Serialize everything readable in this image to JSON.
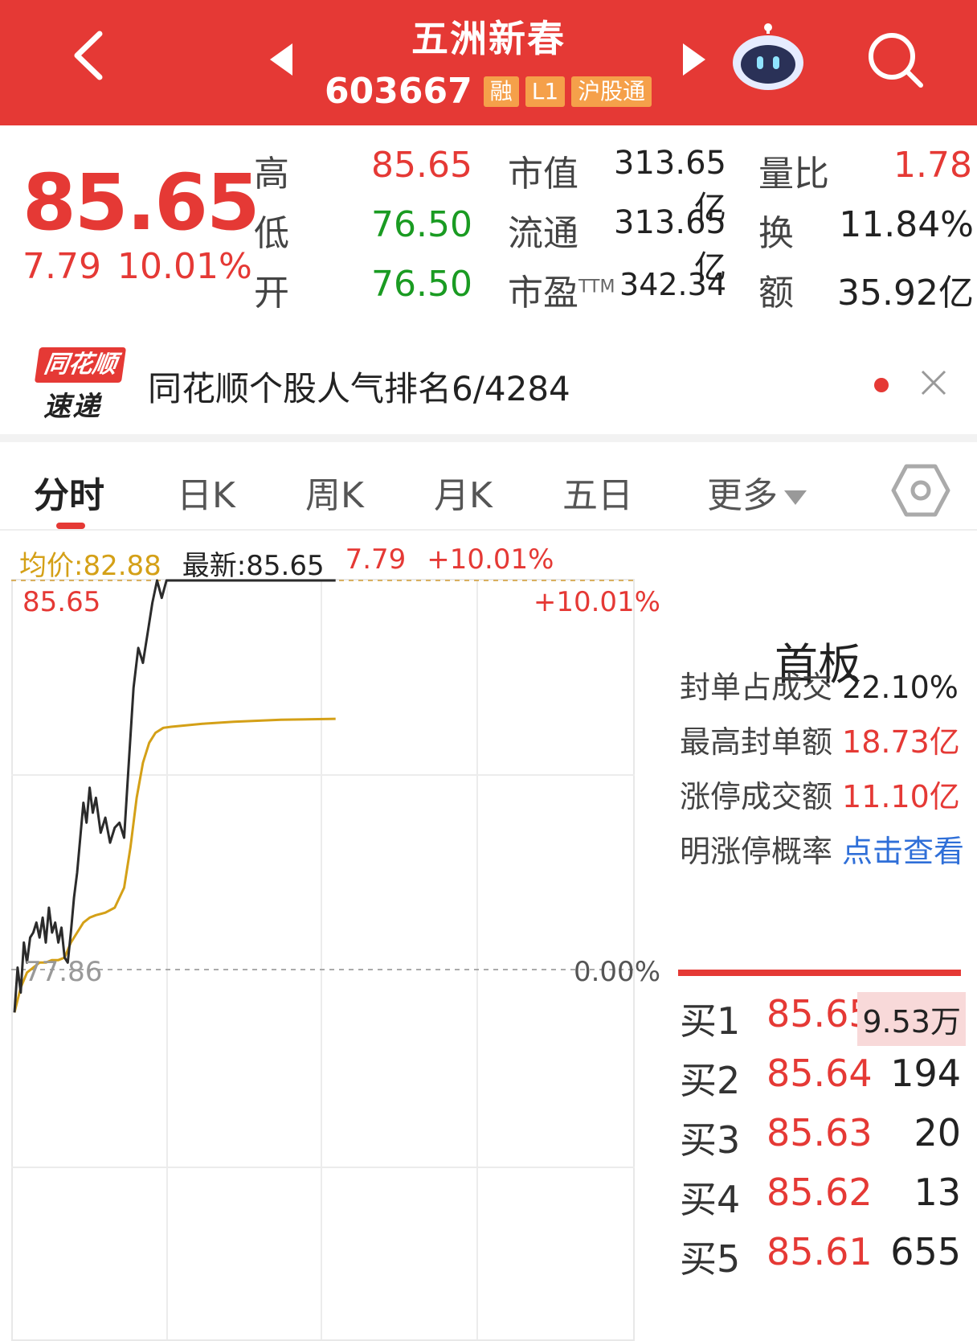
{
  "header": {
    "name": "五洲新春",
    "code": "603667",
    "tags": [
      "融",
      "L1",
      "沪股通"
    ],
    "bg_color": "#e53935"
  },
  "quote": {
    "price": "85.65",
    "change": "7.79",
    "change_pct": "10.01%",
    "high_label": "高",
    "high": "85.65",
    "low_label": "低",
    "low": "76.50",
    "open_label": "开",
    "open": "76.50",
    "mktcap_label": "市值",
    "mktcap": "313.65亿",
    "float_label": "流通",
    "float": "313.65亿",
    "pe_label": "市盈",
    "pe_sup": "TTM",
    "pe": "342.34",
    "volratio_label": "量比",
    "volratio": "1.78",
    "turnover_label": "换",
    "turnover": "11.84%",
    "amount_label": "额",
    "amount": "35.92亿"
  },
  "banner": {
    "logo_top": "同花顺",
    "logo_bottom": "速递",
    "text": "同花顺个股人气排名6/4284"
  },
  "tabs": [
    "分时",
    "日K",
    "周K",
    "月K",
    "五日",
    "更多"
  ],
  "legend": {
    "avg": "均价:82.88",
    "latest": "最新:85.65",
    "chg": "7.79",
    "pct": "+10.01%"
  },
  "chart_labels": {
    "top_price": "85.65",
    "top_pct": "+10.01%",
    "base_price": "77.86",
    "base_pct": "0.00%"
  },
  "chart_data": {
    "type": "line",
    "price_range": [
      77.86,
      85.65
    ],
    "prev_close": 77.86,
    "series": [
      {
        "name": "最新",
        "color": "#2b2b2b",
        "x": [
          0,
          2,
          4,
          6,
          8,
          10,
          12,
          14,
          16,
          18,
          20,
          22,
          24,
          26,
          28,
          30,
          32,
          34,
          36,
          38,
          40,
          42,
          44,
          46,
          48,
          50,
          52,
          55,
          58,
          61,
          64,
          67,
          70,
          73,
          76,
          79,
          82,
          85,
          88,
          91,
          94,
          97,
          100,
          104,
          108,
          112,
          116,
          120,
          140,
          170,
          205
        ],
        "y": [
          77.0,
          77.9,
          77.4,
          78.4,
          78.0,
          78.5,
          78.6,
          78.8,
          78.5,
          78.9,
          78.4,
          79.1,
          78.6,
          78.8,
          78.4,
          78.7,
          78.1,
          78.0,
          78.6,
          79.3,
          79.8,
          80.5,
          81.2,
          80.8,
          81.5,
          81.0,
          81.3,
          80.6,
          80.9,
          80.4,
          80.7,
          80.8,
          80.5,
          82.0,
          83.5,
          84.3,
          84.0,
          84.6,
          85.2,
          85.65,
          85.3,
          85.65,
          85.65,
          85.65,
          85.65,
          85.65,
          85.65,
          85.65,
          85.65,
          85.65,
          85.65
        ]
      },
      {
        "name": "均价",
        "color": "#d4a017",
        "x": [
          0,
          4,
          8,
          12,
          16,
          20,
          24,
          28,
          32,
          36,
          40,
          44,
          48,
          52,
          58,
          64,
          70,
          74,
          78,
          82,
          86,
          90,
          95,
          100,
          120,
          140,
          170,
          205
        ],
        "y": [
          77.0,
          77.5,
          77.8,
          77.9,
          78.0,
          78.0,
          78.05,
          78.05,
          78.1,
          78.4,
          78.6,
          78.8,
          78.9,
          78.95,
          79.0,
          79.1,
          79.5,
          80.3,
          81.3,
          82.0,
          82.4,
          82.6,
          82.7,
          82.72,
          82.78,
          82.82,
          82.86,
          82.88
        ]
      }
    ],
    "x_max": 400
  },
  "panel": {
    "title": "首板",
    "stats": [
      {
        "label": "封单占成交",
        "value": "22.10%",
        "color": "#222"
      },
      {
        "label": "最高封单额",
        "value": "18.73亿",
        "color": "#e53935"
      },
      {
        "label": "涨停成交额",
        "value": "11.10亿",
        "color": "#e53935"
      },
      {
        "label": "明涨停概率",
        "value": "点击查看",
        "color": "#2f6fd8"
      }
    ],
    "orderbook": [
      {
        "label": "买1",
        "price": "85.65",
        "vol": "9.53万"
      },
      {
        "label": "买2",
        "price": "85.64",
        "vol": "194"
      },
      {
        "label": "买3",
        "price": "85.63",
        "vol": "20"
      },
      {
        "label": "买4",
        "price": "85.62",
        "vol": "13"
      },
      {
        "label": "买5",
        "price": "85.61",
        "vol": "655"
      }
    ]
  }
}
